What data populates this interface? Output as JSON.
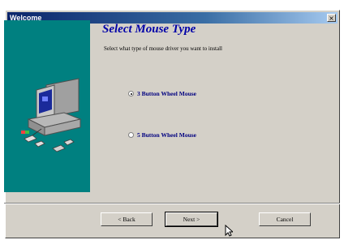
{
  "window": {
    "title": "Welcome",
    "close_glyph": "×"
  },
  "main": {
    "heading": "Select Mouse Type",
    "instruction": "Select what type of mouse driver you want to install",
    "options": [
      {
        "label": "3 Button Wheel Mouse",
        "checked": true
      },
      {
        "label": "5 Button Wheel Mouse",
        "checked": false
      }
    ]
  },
  "buttons": {
    "back": "< Back",
    "next": "Next >",
    "cancel": "Cancel"
  },
  "colors": {
    "panel": "#008080",
    "title_blue": "#0000a8",
    "titlebar": "#0a246a",
    "face": "#d4d0c8"
  },
  "icons": {
    "illustration": "computer-with-mouse-icons",
    "cursor": "arrow-cursor-icon"
  }
}
